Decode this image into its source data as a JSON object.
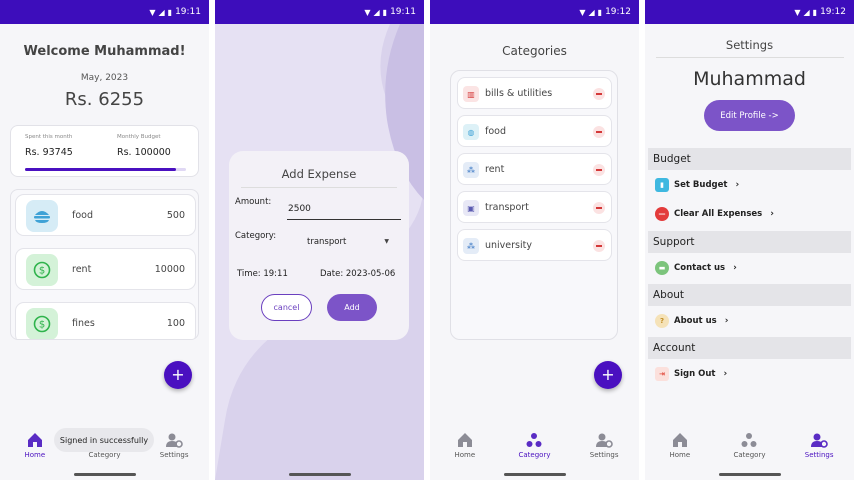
{
  "status": {
    "time1": "19:11",
    "time2": "19:11",
    "time3": "19:12",
    "time4": "19:12"
  },
  "colors": {
    "primary": "#4a10c0",
    "statusbar": "#3d0dbb",
    "button": "#7c54c8"
  },
  "nav": {
    "home": "Home",
    "category": "Category",
    "settings": "Settings"
  },
  "home": {
    "welcome": "Welcome Muhammad!",
    "month": "May, 2023",
    "total": "Rs. 6255",
    "spent_label": "Spent this month",
    "spent_value": "Rs. 93745",
    "budget_label": "Monthly Budget",
    "budget_value": "Rs. 100000",
    "budget_progress": 0.94,
    "expenses": [
      {
        "name": "food",
        "amount": "500",
        "icon": "burger-icon"
      },
      {
        "name": "rent",
        "amount": "10000",
        "icon": "dollar-icon"
      },
      {
        "name": "fines",
        "amount": "100",
        "icon": "dollar-icon"
      }
    ],
    "fab": "+",
    "toast": "Signed in successfully"
  },
  "dialog": {
    "title": "Add Expense",
    "amount_label": "Amount:",
    "amount_value": "2500",
    "category_label": "Category:",
    "category_value": "transport",
    "time": "Time: 19:11",
    "date": "Date: 2023-05-06",
    "cancel": "cancel",
    "add": "Add"
  },
  "categories": {
    "title": "Categories",
    "items": [
      {
        "name": "bills & utilities",
        "icon": "trash-icon"
      },
      {
        "name": "food",
        "icon": "globe-icon"
      },
      {
        "name": "rent",
        "icon": "people-icon"
      },
      {
        "name": "transport",
        "icon": "tram-icon"
      },
      {
        "name": "university",
        "icon": "people-icon"
      }
    ],
    "fab": "+"
  },
  "settings": {
    "title": "Settings",
    "name": "Muhammad",
    "edit_profile": "Edit Profile ->",
    "sections": {
      "budget": "Budget",
      "support": "Support",
      "about": "About",
      "account": "Account"
    },
    "items": {
      "set_budget": "Set Budget",
      "clear_all": "Clear All Expenses",
      "contact_us": "Contact us",
      "about_us": "About us",
      "sign_out": "Sign Out"
    }
  }
}
